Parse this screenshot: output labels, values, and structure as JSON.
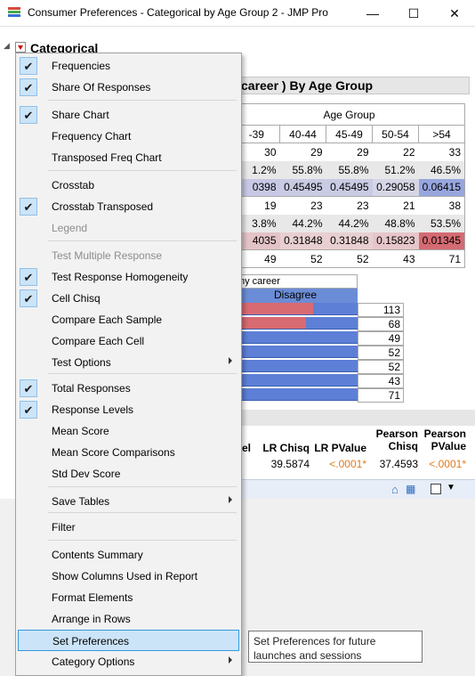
{
  "window": {
    "title": "Consumer Preferences - Categorical by Age Group 2 - JMP Pro",
    "minimize_glyph": "—",
    "maximize_glyph": "☐",
    "close_glyph": "✕"
  },
  "report": {
    "outline_title": "Categorical",
    "subtitle": "career ) By Age Group",
    "crosstab": {
      "group_label": "Age Group",
      "columns": [
        "-39",
        "40-44",
        "45-49",
        "50-54",
        ">54"
      ],
      "rows": [
        [
          "30",
          "29",
          "29",
          "22",
          "33"
        ],
        [
          "1.2%",
          "55.8%",
          "55.8%",
          "51.2%",
          "46.5%"
        ],
        [
          "0398",
          "0.45495",
          "0.45495",
          "0.29058",
          "0.06415"
        ],
        [
          "19",
          "23",
          "23",
          "21",
          "38"
        ],
        [
          "3.8%",
          "44.2%",
          "44.2%",
          "48.8%",
          "53.5%"
        ],
        [
          "4035",
          "0.31848",
          "0.31848",
          "0.15823",
          "0.01345"
        ],
        [
          "49",
          "52",
          "52",
          "43",
          "71"
        ]
      ]
    },
    "bar_chart": {
      "title": "ny career",
      "header": "Disagree",
      "counts": [
        "113",
        "68",
        "49",
        "52",
        "52",
        "43",
        "71"
      ]
    },
    "tests": {
      "headers": [
        "el",
        "LR Chisq",
        "LR PValue",
        "Pearson\nChisq",
        "Pearson\nPValue"
      ],
      "values": [
        "39.5874",
        "<.0001*",
        "37.4593",
        "<.0001*"
      ]
    }
  },
  "menu": {
    "items": [
      {
        "label": "Frequencies",
        "checked": true
      },
      {
        "label": "Share Of Responses",
        "checked": true
      },
      {
        "label": "Share Chart",
        "checked": true
      },
      {
        "label": "Frequency Chart",
        "checked": false
      },
      {
        "label": "Transposed Freq Chart",
        "checked": false
      },
      {
        "label": "Crosstab",
        "checked": false
      },
      {
        "label": "Crosstab Transposed",
        "checked": true
      },
      {
        "label": "Legend",
        "checked": false,
        "disabled": true
      },
      {
        "label": "Test Multiple Response",
        "checked": false,
        "disabled": true
      },
      {
        "label": "Test Response Homogeneity",
        "checked": true
      },
      {
        "label": "Cell Chisq",
        "checked": true
      },
      {
        "label": "Compare Each Sample",
        "checked": false
      },
      {
        "label": "Compare Each Cell",
        "checked": false
      },
      {
        "label": "Test Options",
        "checked": false,
        "submenu": true
      },
      {
        "label": "Total Responses",
        "checked": true
      },
      {
        "label": "Response Levels",
        "checked": true
      },
      {
        "label": "Mean Score",
        "checked": false
      },
      {
        "label": "Mean Score Comparisons",
        "checked": false
      },
      {
        "label": "Std Dev Score",
        "checked": false
      },
      {
        "label": "Save Tables",
        "checked": false,
        "submenu": true
      },
      {
        "label": "Filter",
        "checked": false
      },
      {
        "label": "Contents Summary",
        "checked": false
      },
      {
        "label": "Show Columns Used in Report",
        "checked": false
      },
      {
        "label": "Format Elements",
        "checked": false
      },
      {
        "label": "Arrange in Rows",
        "checked": false
      },
      {
        "label": "Set Preferences",
        "checked": false,
        "highlighted": true
      },
      {
        "label": "Category Options",
        "checked": false,
        "submenu": true
      }
    ]
  },
  "tooltip": {
    "text": "Set Preferences for future launches and sessions"
  },
  "colors": {
    "menu_highlight": "#cce4f7",
    "bar_blue": "#5d7fd6",
    "bar_red": "#d86a72",
    "pvalue_orange": "#e07a1f"
  }
}
